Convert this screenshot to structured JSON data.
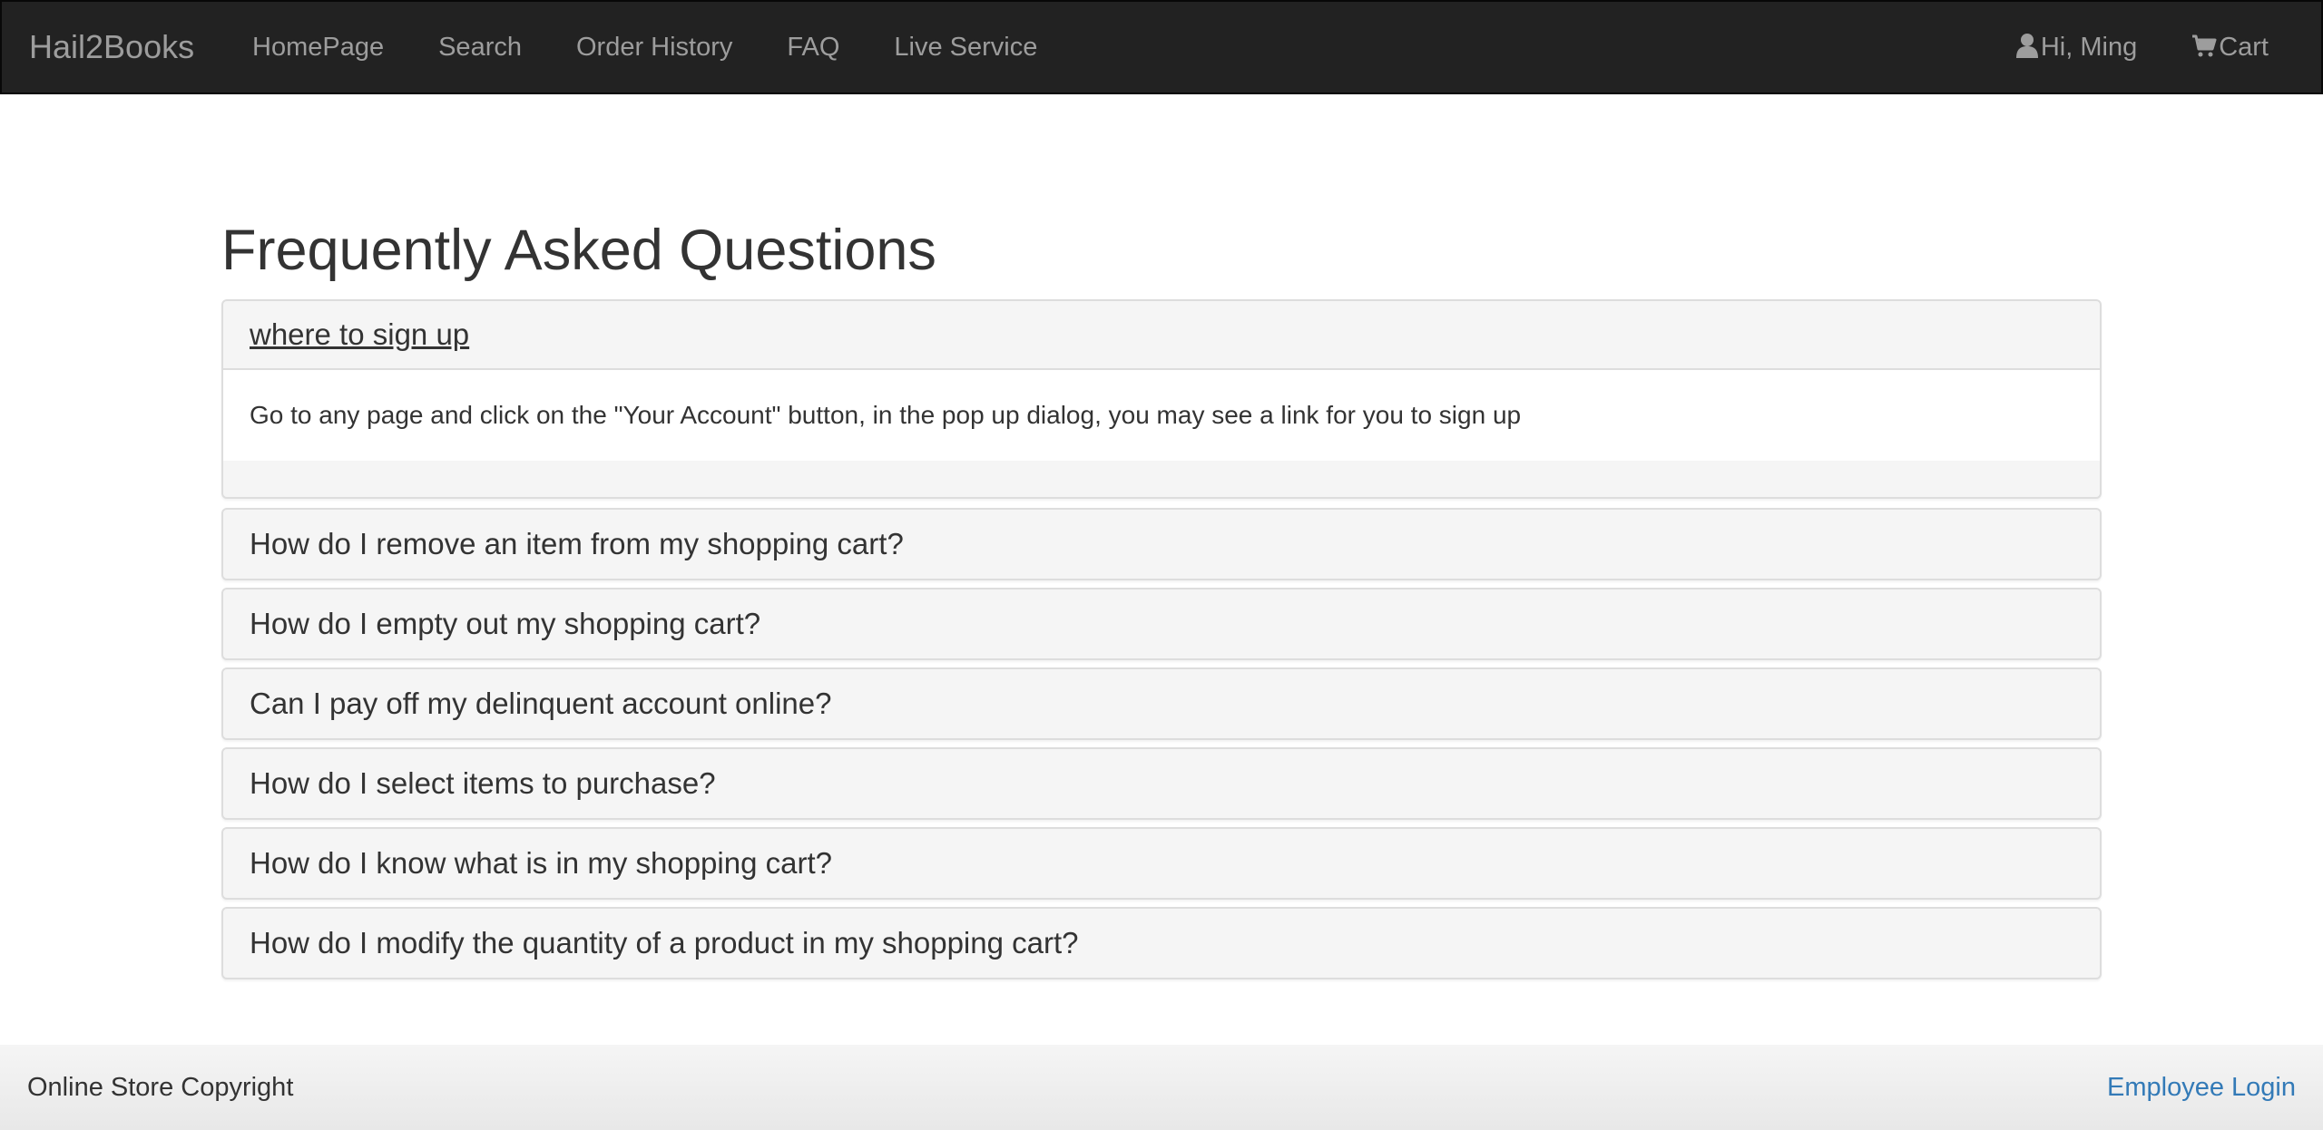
{
  "navbar": {
    "brand": "Hail2Books",
    "links": [
      {
        "label": "HomePage"
      },
      {
        "label": "Search"
      },
      {
        "label": "Order History"
      },
      {
        "label": "FAQ"
      },
      {
        "label": "Live Service"
      }
    ],
    "user": {
      "label": "Hi, Ming",
      "icon": "user-icon"
    },
    "cart": {
      "label": "Cart",
      "icon": "shopping-cart-icon"
    }
  },
  "main": {
    "title": "Frequently Asked Questions",
    "faq": [
      {
        "question": "where to sign up",
        "answer": "Go to any page and click on the \"Your Account\" button, in the pop up dialog, you may see a link for you to sign up",
        "expanded": true
      },
      {
        "question": "How do I remove an item from my shopping cart?",
        "expanded": false
      },
      {
        "question": "How do I empty out my shopping cart?",
        "expanded": false
      },
      {
        "question": "Can I pay off my delinquent account online?",
        "expanded": false
      },
      {
        "question": "How do I select items to purchase?",
        "expanded": false
      },
      {
        "question": "How do I know what is in my shopping cart?",
        "expanded": false
      },
      {
        "question": "How do I modify the quantity of a product in my shopping cart?",
        "expanded": false
      }
    ]
  },
  "footer": {
    "copyright": "Online Store Copyright",
    "employee_login": "Employee Login"
  },
  "colors": {
    "navbar_bg": "#222222",
    "nav_text": "#9d9d9d",
    "panel_bg": "#f5f5f5",
    "link": "#337ab7"
  }
}
